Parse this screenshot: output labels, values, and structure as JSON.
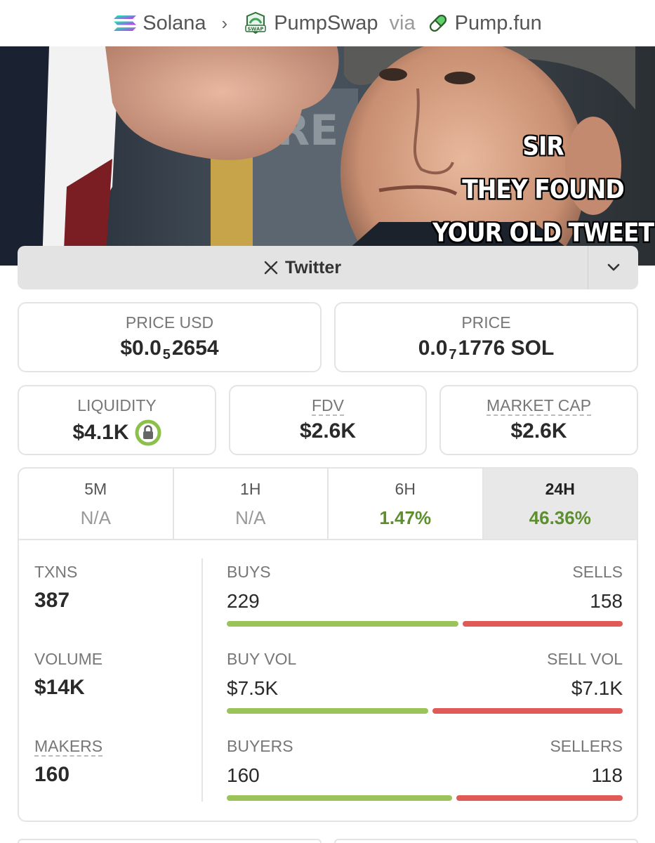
{
  "breadcrumb": {
    "chain": "Solana",
    "dex": "PumpSwap",
    "dex_badge": "SWAP",
    "via": "via",
    "launchpad": "Pump.fun"
  },
  "banner": {
    "meme_lines": [
      "SIR",
      "THEY FOUND",
      "YOUR OLD TWEET"
    ],
    "background_text": "RE"
  },
  "social": {
    "twitter_label": "Twitter"
  },
  "price": {
    "usd_label": "PRICE USD",
    "usd_prefix": "$0.0",
    "usd_zeros": "5",
    "usd_digits": "2654",
    "native_label": "PRICE",
    "native_prefix": "0.0",
    "native_zeros": "7",
    "native_digits": "1776 SOL"
  },
  "metrics": {
    "liquidity_label": "LIQUIDITY",
    "liquidity_value": "$4.1K",
    "fdv_label": "FDV",
    "fdv_value": "$2.6K",
    "mcap_label": "MARKET CAP",
    "mcap_value": "$2.6K"
  },
  "timeframes": [
    {
      "label": "5M",
      "value": "N/A"
    },
    {
      "label": "1H",
      "value": "N/A"
    },
    {
      "label": "6H",
      "value": "1.47%"
    },
    {
      "label": "24H",
      "value": "46.36%"
    }
  ],
  "activity": {
    "txns_label": "TXNS",
    "txns": "387",
    "volume_label": "VOLUME",
    "volume": "$14K",
    "makers_label": "MAKERS",
    "makers": "160",
    "buys_label": "BUYS",
    "buys": "229",
    "sells_label": "SELLS",
    "sells": "158",
    "buy_vol_label": "BUY VOL",
    "buy_vol": "$7.5K",
    "sell_vol_label": "SELL VOL",
    "sell_vol": "$7.1K",
    "buyers_label": "BUYERS",
    "buyers": "160",
    "sellers_label": "SELLERS",
    "sellers": "118",
    "buy_share_txns": 0.592,
    "buy_share_vol": 0.514,
    "buy_share_makers": 0.576
  },
  "colors": {
    "positive": "#5d8f2f",
    "buy_bar": "#9ac45a",
    "sell_bar": "#e05b57"
  }
}
